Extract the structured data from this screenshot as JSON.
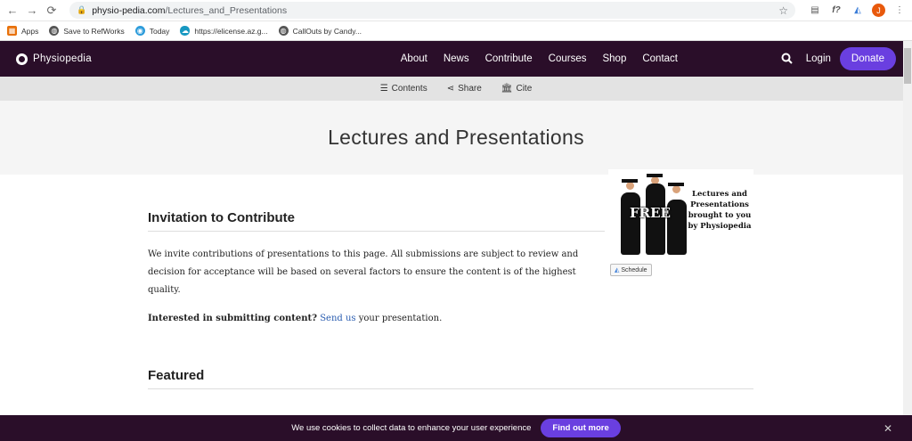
{
  "browser": {
    "url_host": "physio-pedia.com",
    "url_path": "/Lectures_and_Presentations",
    "profile_initial": "J",
    "bookmarks": [
      "Apps",
      "Save to RefWorks",
      "Today",
      "https://elicense.az.g...",
      "CallOuts by Candy..."
    ]
  },
  "site": {
    "logo_text": "Physiopedia",
    "menu": [
      "About",
      "News",
      "Contribute",
      "Courses",
      "Shop",
      "Contact"
    ],
    "login": "Login",
    "donate": "Donate"
  },
  "subbar": {
    "contents": "Contents",
    "share": "Share",
    "cite": "Cite"
  },
  "page": {
    "title": "Lectures and Presentations",
    "invitation_heading": "Invitation to Contribute",
    "invitation_text": "We invite contributions of presentations to this page.  All submissions are subject to review and decision for acceptance will be based on several factors to ensure the content is of the highest quality.",
    "interested_bold": "Interested in submitting content?",
    "send_us_link": "Send us",
    "interested_tail": " your presentation.",
    "featured_heading": "Featured"
  },
  "promo": {
    "free": "FREE",
    "text": "Lectures and Presentations brought to you by Physiopedia",
    "schedule": "Schedule"
  },
  "cookie": {
    "message": "We use cookies to collect data to enhance your user experience",
    "button": "Find out more",
    "close": "✕"
  },
  "colors": {
    "nav_bg": "#2a0e29",
    "accent": "#6a3fe0",
    "link": "#2a5db0"
  }
}
